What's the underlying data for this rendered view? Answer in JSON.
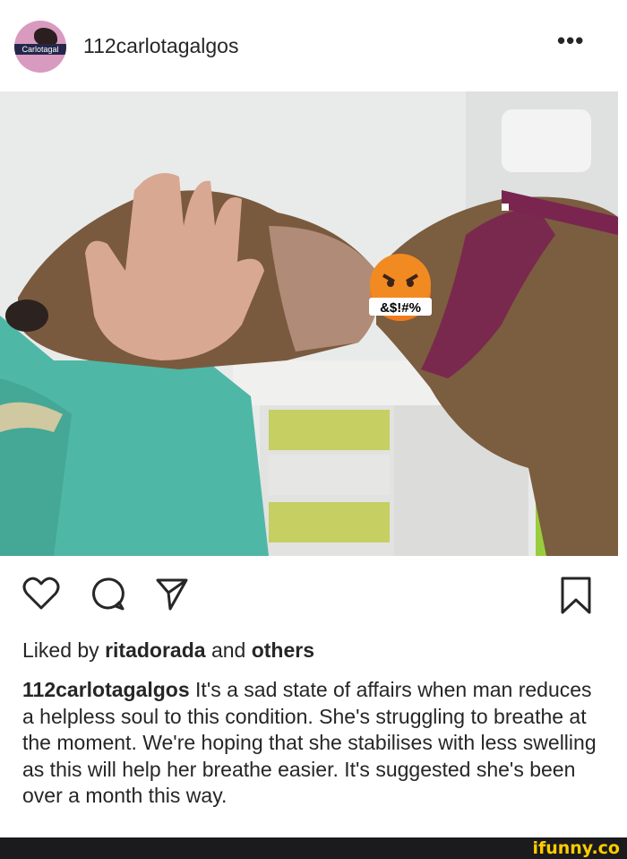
{
  "post": {
    "username": "112carlotagalgos",
    "avatar_text": "Carlotagal",
    "more_icon": "more-horizontal-icon",
    "emoji_text": "&$!#%",
    "liked_prefix": "Liked by",
    "liked_user": "ritadorada",
    "liked_and": "and",
    "liked_others": "others",
    "caption_user": "112carlotagalgos",
    "caption_text": " It's a sad state of affairs when man reduces a helpless soul to this condition. She's struggling to breathe at the moment. We're hoping that she stabilises with less swelling as this will help her breathe easier. It's suggested she's been over a month this way."
  },
  "watermark": "ifunny.co",
  "colors": {
    "text": "#262626",
    "watermark": "#ffcc00",
    "harness": "#7a2450",
    "jacket": "#4fb7a6"
  }
}
